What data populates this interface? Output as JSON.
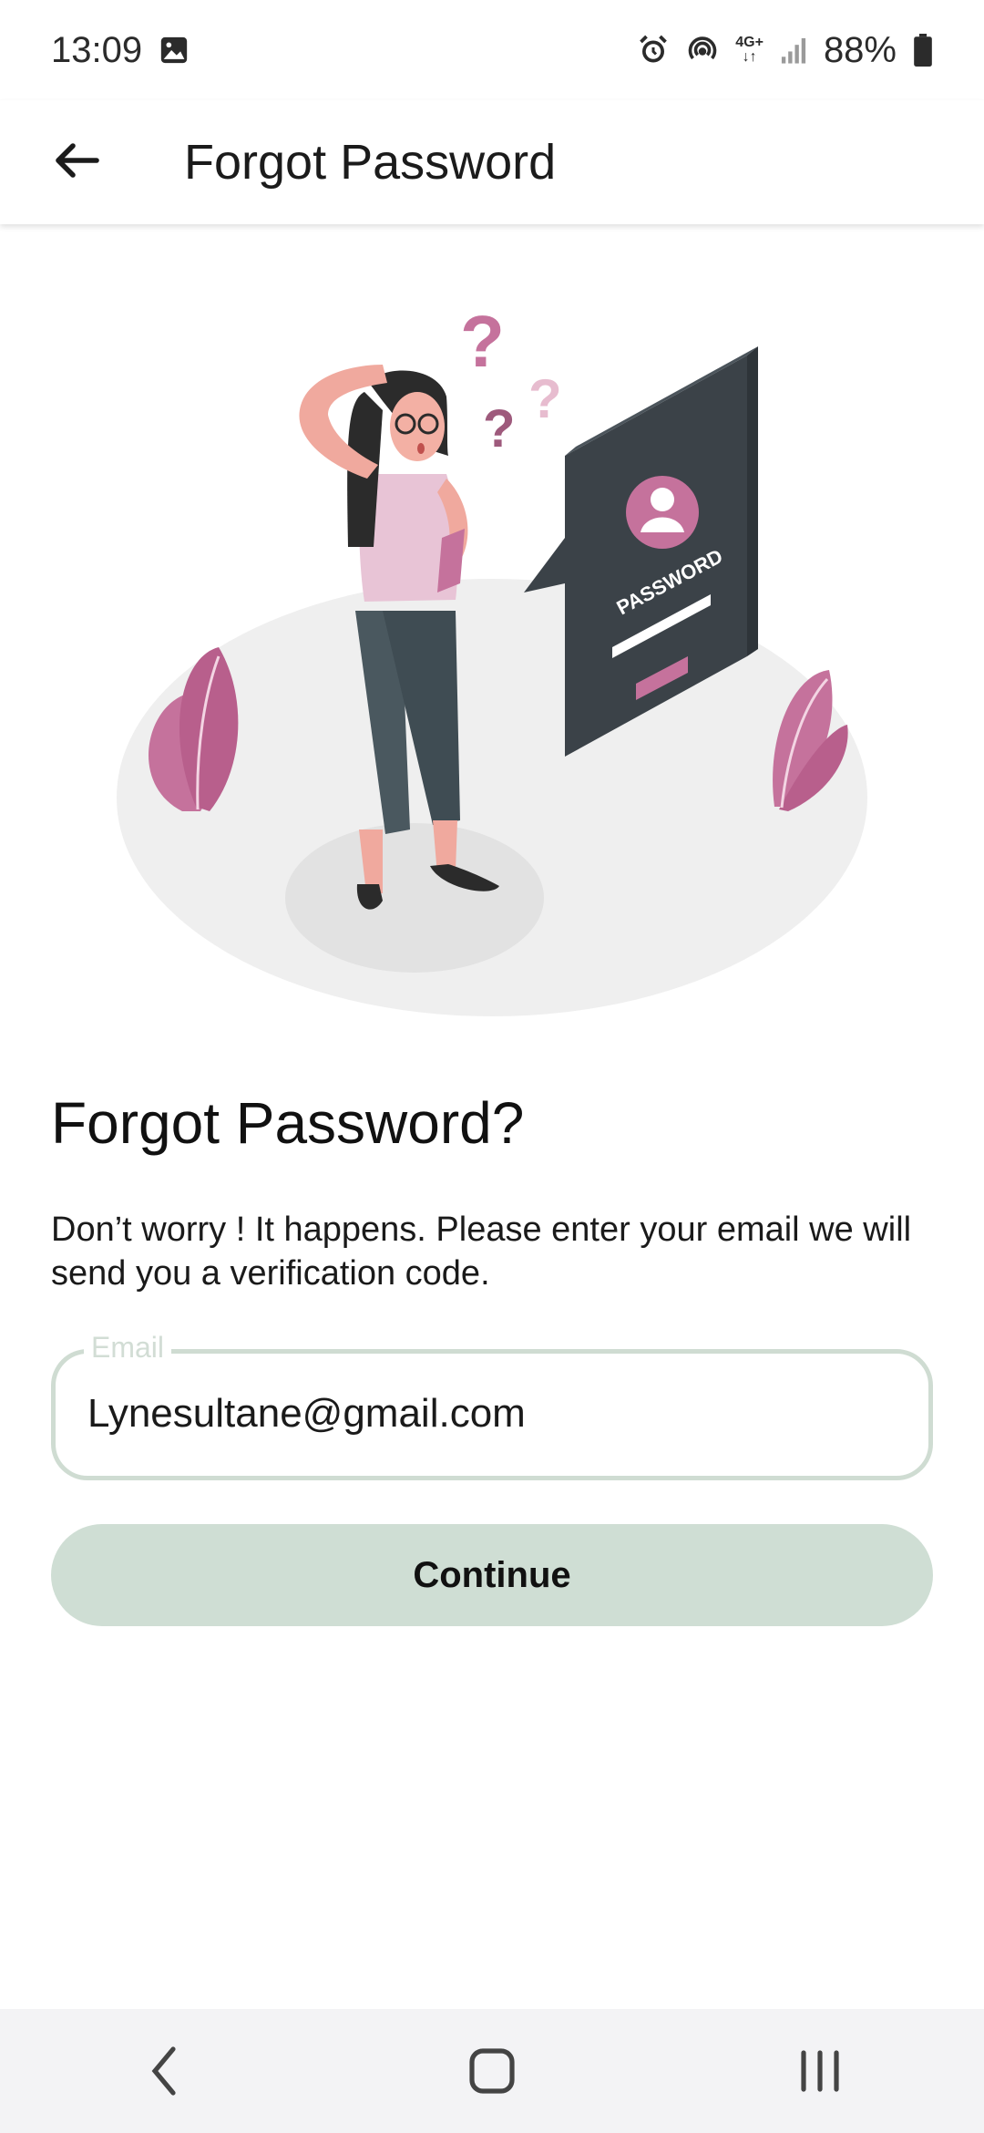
{
  "status_bar": {
    "time": "13:09",
    "battery": "88%",
    "network": "4G+",
    "icons": [
      "image-icon",
      "alarm-icon",
      "hotspot-icon",
      "network-4g-icon",
      "signal-icon",
      "battery-icon"
    ]
  },
  "app_bar": {
    "title": "Forgot Password",
    "back_icon": "arrow-left-icon"
  },
  "illustration": {
    "panel_text": "PASSWORD",
    "accent": "#c5729c",
    "dark": "#3b4248"
  },
  "main": {
    "heading": "Forgot Password?",
    "description": "Don’t worry ! It happens. Please enter your email we will send you a verification code."
  },
  "email": {
    "label": "Email",
    "value": "Lynesultane@gmail.com"
  },
  "continue": {
    "label": "Continue"
  },
  "colors": {
    "button_bg": "#cfded4",
    "field_border": "#cfdcd2",
    "illustration_accent": "#c5729c"
  },
  "nav_bar": {
    "items": [
      "back-nav-icon",
      "home-nav-icon",
      "recents-nav-icon"
    ]
  }
}
